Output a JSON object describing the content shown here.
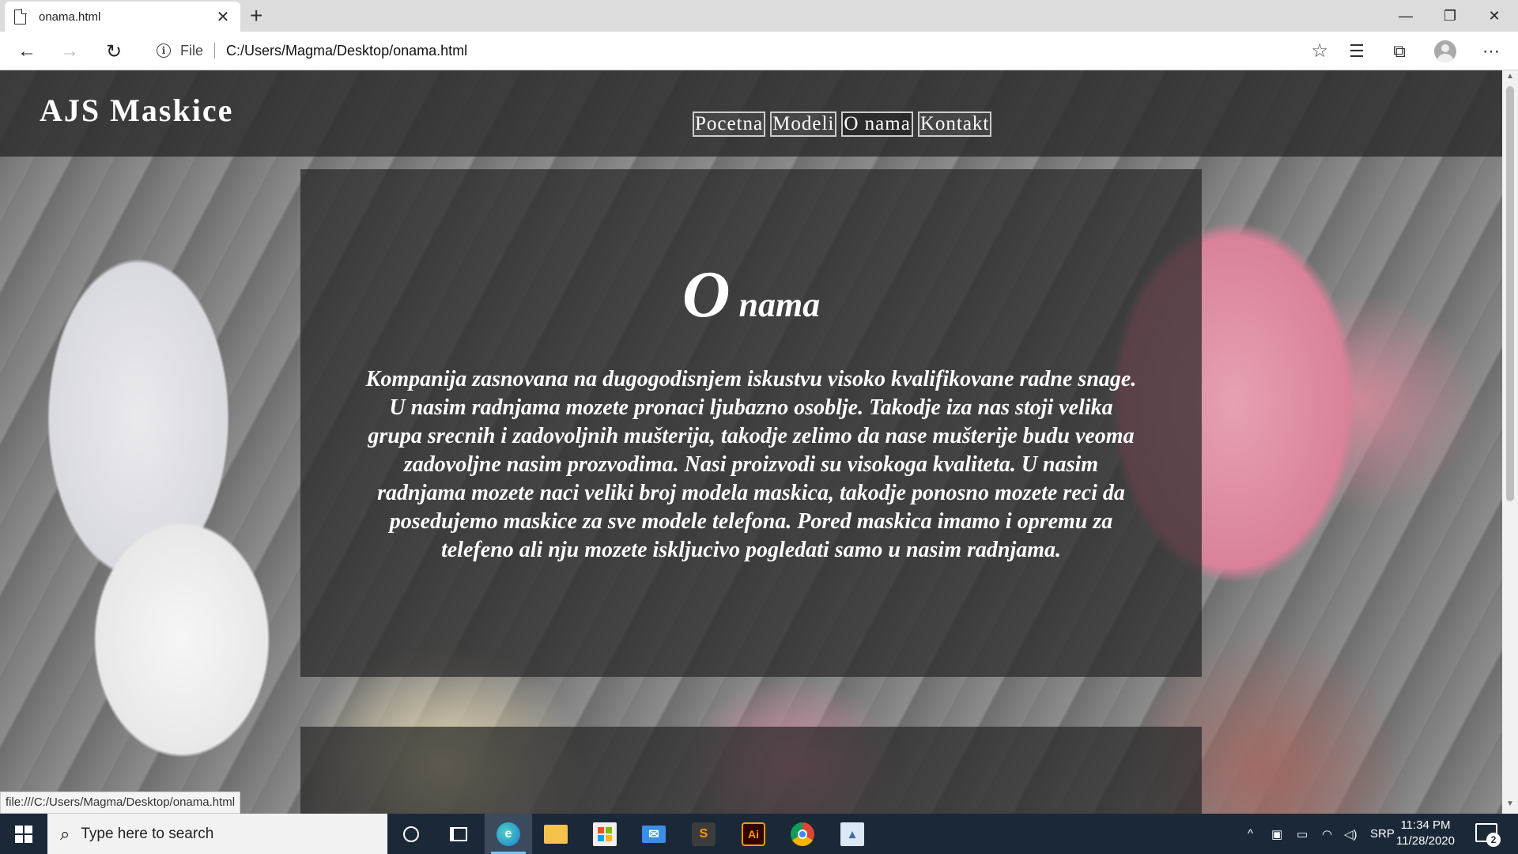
{
  "browser": {
    "tab_title": "onama.html",
    "new_tab_symbol": "+",
    "file_label": "File",
    "url": "C:/Users/Magma/Desktop/onama.html",
    "status_url": "file:///C:/Users/Magma/Desktop/onama.html"
  },
  "site": {
    "logo": "AJS Maskice",
    "nav": [
      {
        "label": "Pocetna",
        "active": false
      },
      {
        "label": "Modeli",
        "active": false
      },
      {
        "label": "O nama",
        "active": true
      },
      {
        "label": "Kontakt",
        "active": false
      }
    ],
    "about": {
      "title_first": "O",
      "title_rest": " nama",
      "text": "Kompanija zasnovana na dugogodisnjem iskustvu visoko kvalifikovane radne snage. U nasim radnjama mozete pronaci ljubazno osoblje. Takodje iza nas stoji velika grupa srecnih i zadovoljnih mušterija, takodje zelimo da nase mušterije budu veoma zadovoljne nasim prozvodima. Nasi proizvodi su visokoga kvaliteta. U nasim radnjama mozete naci veliki broj modela maskica, takodje ponosno mozete reci da posedujemo maskice za sve modele telefona. Pored maskica imamo i opremu za telefeno ali nju mozete iskljucivo pogledati samo u nasim radnjama."
    }
  },
  "taskbar": {
    "search_placeholder": "Type here to search",
    "language": "SRP",
    "time": "11:34 PM",
    "date": "11/28/2020",
    "notification_count": "2",
    "pinned_apps": [
      "cortana-icon",
      "task-view-icon",
      "edge-icon",
      "file-explorer-icon",
      "store-icon",
      "mail-icon",
      "sublime-text-icon",
      "illustrator-icon",
      "chrome-icon",
      "photos-icon"
    ]
  },
  "colors": {
    "header_overlay": "#282828",
    "taskbar": "#1b2838",
    "accent": "#7cc3f5"
  }
}
